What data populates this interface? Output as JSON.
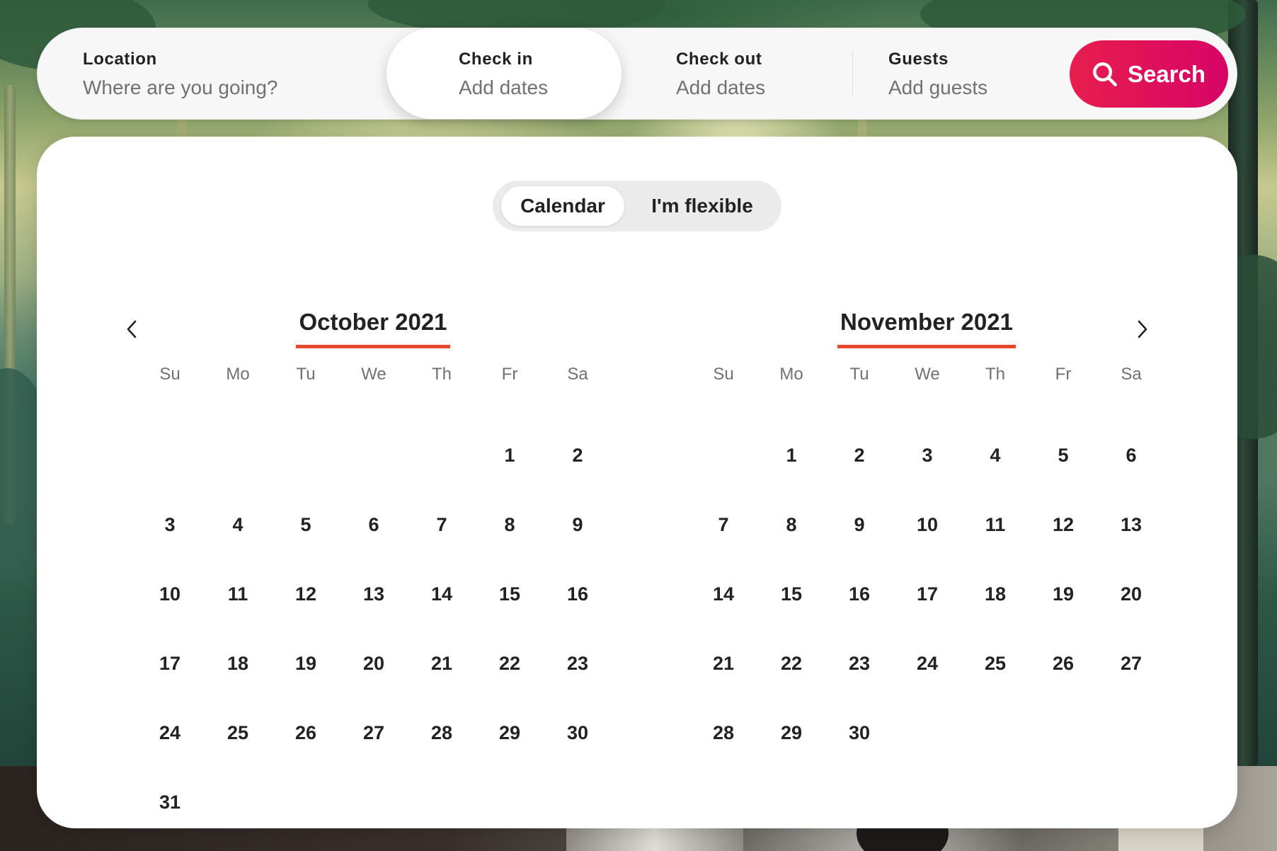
{
  "search": {
    "location_label": "Location",
    "location_placeholder": "Where are you going?",
    "checkin_label": "Check in",
    "checkin_value": "Add dates",
    "checkout_label": "Check out",
    "checkout_value": "Add dates",
    "guests_label": "Guests",
    "guests_value": "Add guests",
    "search_button_label": "Search",
    "search_button_colors": [
      "#E61E4D",
      "#D70466"
    ],
    "search_icon": "search-icon"
  },
  "date_picker": {
    "mode_options": [
      {
        "label": "Calendar",
        "selected": true
      },
      {
        "label": "I'm flexible",
        "selected": false
      }
    ],
    "prev_icon": "chevron-left-icon",
    "next_icon": "chevron-right-icon",
    "accent_color": "#E8462A",
    "months": [
      {
        "title": "October 2021",
        "weekdays": [
          "Su",
          "Mo",
          "Tu",
          "We",
          "Th",
          "Fr",
          "Sa"
        ],
        "first_weekday_index": 5,
        "days": [
          "1",
          "2",
          "3",
          "4",
          "5",
          "6",
          "7",
          "8",
          "9",
          "10",
          "11",
          "12",
          "13",
          "14",
          "15",
          "16",
          "17",
          "18",
          "19",
          "20",
          "21",
          "22",
          "23",
          "24",
          "25",
          "26",
          "27",
          "28",
          "29",
          "30",
          "31"
        ]
      },
      {
        "title": "November 2021",
        "weekdays": [
          "Su",
          "Mo",
          "Tu",
          "We",
          "Th",
          "Fr",
          "Sa"
        ],
        "first_weekday_index": 1,
        "days": [
          "1",
          "2",
          "3",
          "4",
          "5",
          "6",
          "7",
          "8",
          "9",
          "10",
          "11",
          "12",
          "13",
          "14",
          "15",
          "16",
          "17",
          "18",
          "19",
          "20",
          "21",
          "22",
          "23",
          "24",
          "25",
          "26",
          "27",
          "28",
          "29",
          "30"
        ]
      }
    ]
  }
}
